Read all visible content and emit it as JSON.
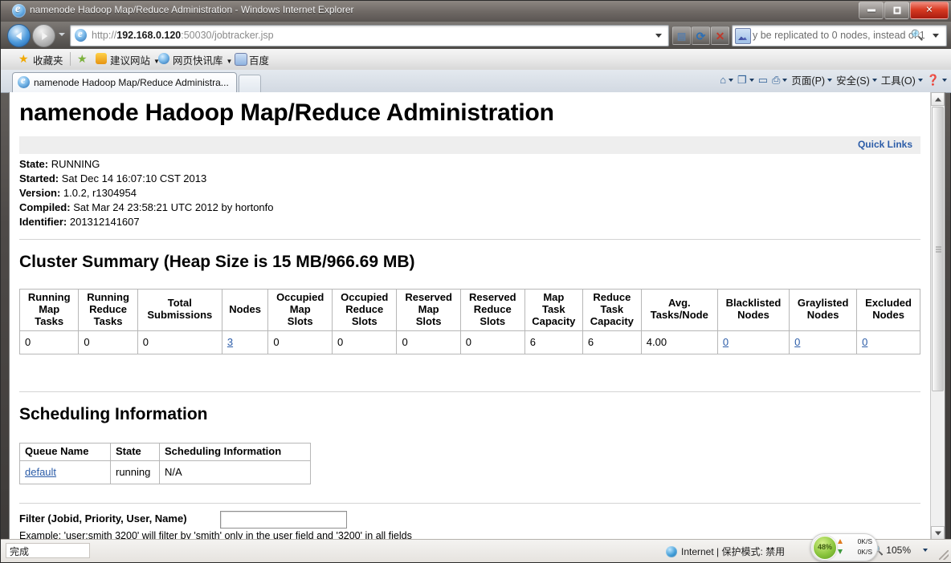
{
  "window": {
    "title": "namenode Hadoop Map/Reduce Administration - Windows Internet Explorer",
    "minimize_label": "",
    "maximize_label": "",
    "close_label": "✕"
  },
  "nav": {
    "back_label": "Back",
    "forward_label": "Forward",
    "url_prefix": "http://",
    "url_host": "192.168.0.120",
    "url_suffix": ":50030/jobtracker.jsp",
    "compat_icon": "compatibility-view-icon",
    "refresh_icon": "⟳",
    "stop_icon": "✕",
    "search_value": "y be replicated to 0 nodes, instead of 1",
    "search_placeholder": "",
    "search_icon": "baidu-search-icon",
    "magnifier": "🔍"
  },
  "favorites": {
    "label": "收藏夹",
    "items": [
      {
        "label": "建议网站",
        "has_caret": true
      },
      {
        "label": "网页快讯库",
        "has_caret": true
      },
      {
        "label": "百度",
        "has_caret": false
      }
    ]
  },
  "tabs": {
    "active": "namenode Hadoop Map/Reduce Administra...",
    "new_tab_label": ""
  },
  "command_bar": {
    "home_icon": "🏠",
    "feeds_icon": "feeds-icon",
    "mail_icon": "mail-icon",
    "print_icon": "print-icon",
    "items": [
      {
        "label": "页面(P)"
      },
      {
        "label": "安全(S)"
      },
      {
        "label": "工具(O)"
      }
    ],
    "help_icon": "?"
  },
  "page": {
    "heading": "namenode Hadoop Map/Reduce Administration",
    "quick_links": "Quick Links",
    "info": [
      {
        "key": "State:",
        "value": "RUNNING"
      },
      {
        "key": "Started:",
        "value": "Sat Dec 14 16:07:10 CST 2013"
      },
      {
        "key": "Version:",
        "value": "1.0.2, r1304954"
      },
      {
        "key": "Compiled:",
        "value": "Sat Mar 24 23:58:21 UTC 2012 by hortonfo"
      },
      {
        "key": "Identifier:",
        "value": "201312141607"
      }
    ],
    "cluster_summary": {
      "heading": "Cluster Summary (Heap Size is 15 MB/966.69 MB)",
      "columns": [
        "Running Map Tasks",
        "Running Reduce Tasks",
        "Total Submissions",
        "Nodes",
        "Occupied Map Slots",
        "Occupied Reduce Slots",
        "Reserved Map Slots",
        "Reserved Reduce Slots",
        "Map Task Capacity",
        "Reduce Task Capacity",
        "Avg. Tasks/Node",
        "Blacklisted Nodes",
        "Graylisted Nodes",
        "Excluded Nodes"
      ],
      "row": [
        {
          "value": "0",
          "link": false
        },
        {
          "value": "0",
          "link": false
        },
        {
          "value": "0",
          "link": false
        },
        {
          "value": "3",
          "link": true
        },
        {
          "value": "0",
          "link": false
        },
        {
          "value": "0",
          "link": false
        },
        {
          "value": "0",
          "link": false
        },
        {
          "value": "0",
          "link": false
        },
        {
          "value": "6",
          "link": false
        },
        {
          "value": "6",
          "link": false
        },
        {
          "value": "4.00",
          "link": false
        },
        {
          "value": "0",
          "link": true
        },
        {
          "value": "0",
          "link": true
        },
        {
          "value": "0",
          "link": true
        }
      ]
    },
    "scheduling": {
      "heading": "Scheduling Information",
      "columns": [
        "Queue Name",
        "State",
        "Scheduling Information"
      ],
      "rows": [
        {
          "queue": "default",
          "state": "running",
          "info": "N/A"
        }
      ]
    },
    "filter": {
      "label": "Filter (Jobid, Priority, User, Name)",
      "value": "",
      "placeholder": "",
      "example": "Example: 'user:smith 3200' will filter by 'smith' only in the user field and '3200' in all fields"
    }
  },
  "status": {
    "text": "完成",
    "zone": "Internet | 保护模式: 禁用",
    "zoom": "105%",
    "network": {
      "percent": "48%",
      "upload": "0K/S",
      "download": "0K/S"
    }
  },
  "colors": {
    "link": "#2b5ca8",
    "heading": "#000000",
    "quick_links": "#2b5ca8",
    "accent_green": "#8cc63f"
  }
}
